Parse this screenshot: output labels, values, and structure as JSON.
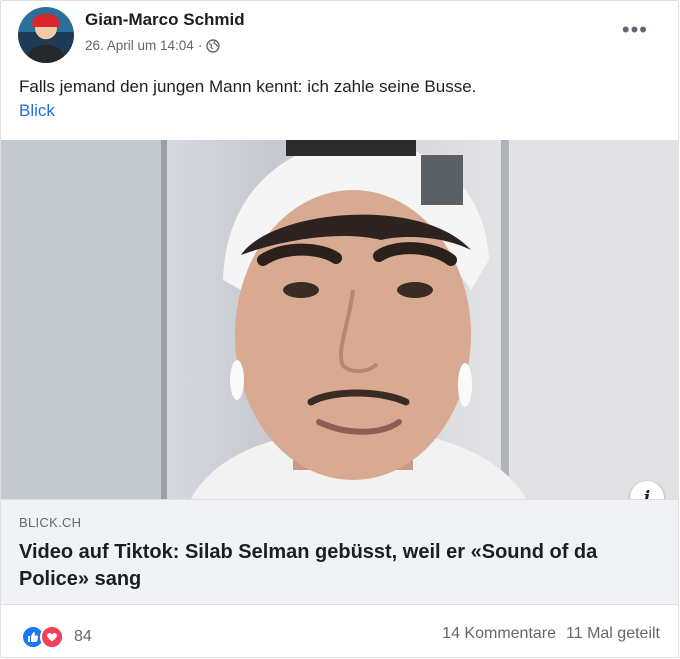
{
  "post": {
    "author": "Gian-Marco Schmid",
    "date": "26. April um 14:04",
    "separator": "·",
    "more_label": "•••",
    "text": "Falls jemand den jungen Mann kennt: ich zahle seine Busse.",
    "link_text": "Blick"
  },
  "link_preview": {
    "domain": "BLICK.CH",
    "headline": "Video auf Tiktok: Silab Selman gebüsst, weil er «Sound of da Police» sang",
    "info_label": "i"
  },
  "footer": {
    "reaction_count": "84",
    "comments": "14 Kommentare",
    "shares": "11 Mal geteilt"
  },
  "colors": {
    "like": "#1877f2",
    "love": "#f33e58",
    "link": "#216fdb"
  }
}
